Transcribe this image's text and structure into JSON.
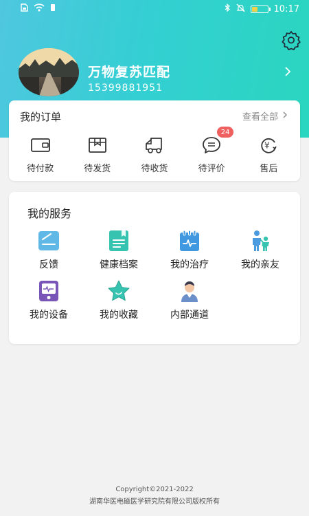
{
  "status_bar": {
    "time": "10:17",
    "icons": [
      "sim-icon",
      "wifi-icon",
      "signal-icon",
      "bluetooth-icon",
      "mute-icon",
      "battery-icon"
    ]
  },
  "profile": {
    "name": "万物复苏匹配",
    "phone": "15399881951",
    "arrow_icon": "chevron-right-icon",
    "settings_icon": "gear-icon"
  },
  "orders": {
    "title": "我的订单",
    "view_all": "查看全部",
    "items": [
      {
        "label": "待付款",
        "icon": "wallet-icon"
      },
      {
        "label": "待发货",
        "icon": "box-icon"
      },
      {
        "label": "待收货",
        "icon": "truck-icon"
      },
      {
        "label": "待评价",
        "icon": "comment-icon",
        "badge": "24"
      },
      {
        "label": "售后",
        "icon": "refund-icon"
      }
    ]
  },
  "services": {
    "title": "我的服务",
    "items": [
      {
        "label": "反馈",
        "icon": "feedback-icon"
      },
      {
        "label": "健康档案",
        "icon": "health-record-icon"
      },
      {
        "label": "我的治疗",
        "icon": "treatment-icon"
      },
      {
        "label": "我的亲友",
        "icon": "family-icon"
      },
      {
        "label": "我的设备",
        "icon": "device-icon"
      },
      {
        "label": "我的收藏",
        "icon": "star-icon"
      },
      {
        "label": "内部通道",
        "icon": "staff-icon"
      }
    ]
  },
  "footer": {
    "copyright": "Copyright©2021-2022",
    "company": "湖南华医电磁医学研究院有限公司版权所有"
  },
  "colors": {
    "header_gradient_start": "#4fc7df",
    "header_gradient_end": "#2ad6bf",
    "badge": "#f06060",
    "icon_teal": "#36c3b0"
  }
}
